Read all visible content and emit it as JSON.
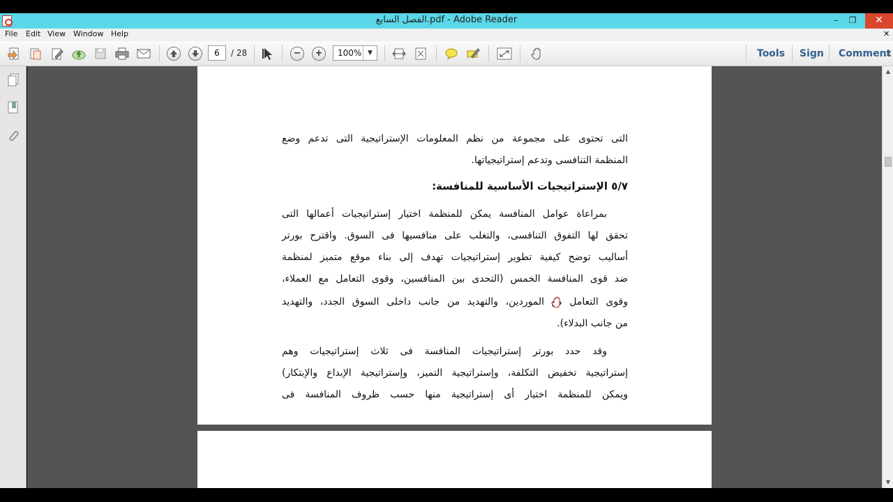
{
  "window": {
    "title": "الفصل السابع.pdf - Adobe Reader",
    "minimize_glyph": "–",
    "restore_glyph": "❐",
    "close_glyph": "✕"
  },
  "menu": {
    "items": [
      "File",
      "Edit",
      "View",
      "Window",
      "Help"
    ],
    "close_glyph": "✕"
  },
  "toolbar": {
    "page_current": "6",
    "page_total": "/ 28",
    "zoom": "100%",
    "zoom_arrow": "▼",
    "tools_label": "Tools",
    "sign_label": "Sign",
    "comment_label": "Comment",
    "close_glyph": "✕",
    "zoom_out_glyph": "−",
    "zoom_in_glyph": "+"
  },
  "document": {
    "lines_top": [
      "التى تحتوى على مجموعة من نظم المعلومات الإستراتيجية التى تدعم وضع",
      "المنظمة التنافسى وتدعم إستراتيجياتها."
    ],
    "heading": "٥/٧ الإستراتيجيات الأساسية للمنافسة:",
    "paragraph1": [
      "بمراعاة عوامل المنافسة يمكن للمنظمة اختيار إستراتيجيات أعمالها التى",
      "تحقق لها التفوق التنافسى، والتغلب على منافسيها فى السوق. واقترح بورتر",
      "أساليب توضح كيفية تطوير إستراتيجيات تهدف إلى بناء موقع متميز لمنظمة",
      "ضد قوى المنافسة الخمس (التحدى بين المنافسين، وقوى التعامل مع العملاء،",
      "وقوى التعامل مع الموردين، والتهديد من جانب داخلى السوق الجدد، والتهديد",
      "من جانب البدلاء)."
    ],
    "paragraph2": [
      "وقد حدد بورتر إستراتيجيات المنافسة فى ثلاث إستراتيجيات وهم",
      "إستراتيجية تخفيض التكلفة، وإستراتيجية التميز، وإستراتيجية الإبداع والإبتكار)",
      "ويمكن للمنظمة اختيار أى إستراتيجية منها حسب ظروف المنافسة فى"
    ]
  },
  "colors": {
    "titlebar": "#5ad8ea",
    "close_button": "#d9472e",
    "doc_background": "#545454",
    "toolbar_text": "#35618f"
  }
}
